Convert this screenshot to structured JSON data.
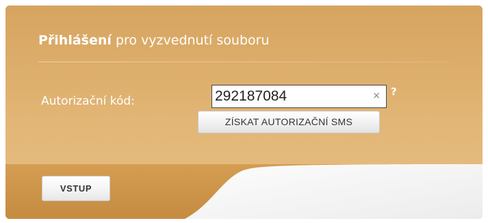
{
  "header": {
    "title_strong": "Přihlášení",
    "title_rest": " pro vyzvednutí souboru"
  },
  "form": {
    "code_label": "Autorizační kód:",
    "code_value": "292187084",
    "clear_symbol": "×",
    "help_symbol": "?",
    "sms_button_label": "ZÍSKAT AUTORIZAČNÍ SMS"
  },
  "footer": {
    "enter_button_label": "VSTUP"
  },
  "colors": {
    "panel": "#dcaa66",
    "footer_dark": "#c78f45",
    "footer_light": "#f4f4f4"
  }
}
